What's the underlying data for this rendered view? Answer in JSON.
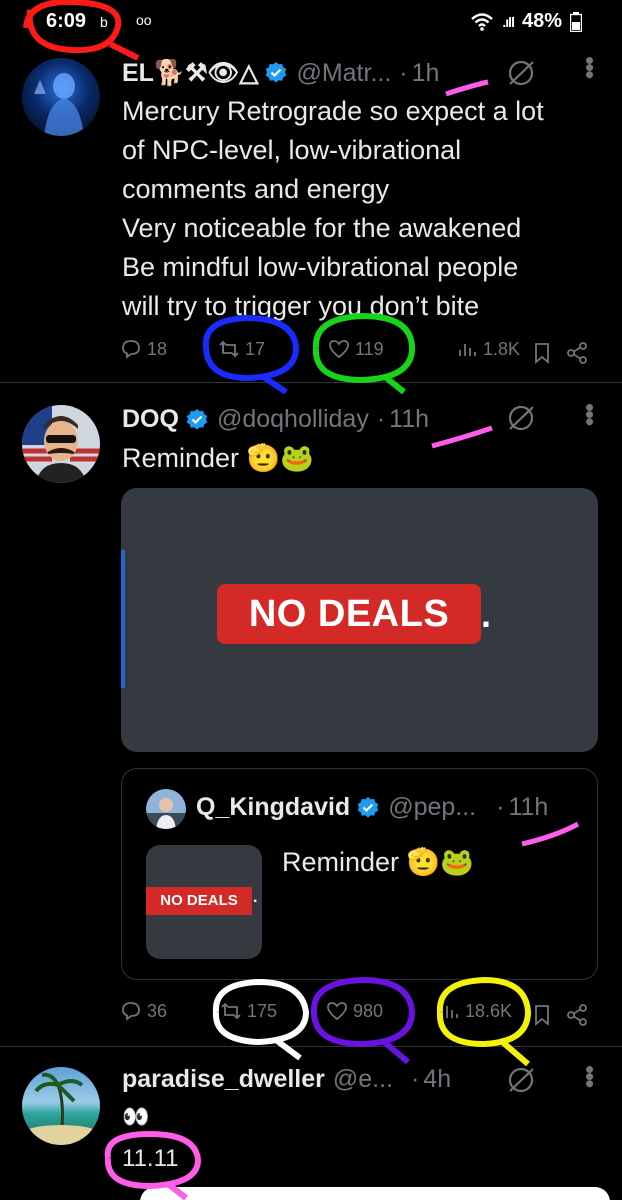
{
  "status_bar": {
    "time": "6:09",
    "small_icon": "b",
    "voicemail": "oo",
    "battery": "48%",
    "signal": ".ıll"
  },
  "tweets": [
    {
      "name": "EL🐕⚒👁△",
      "handle": "@Matr...",
      "dot": "·",
      "time": "1h",
      "text_lines": [
        "Mercury Retrograde so expect a lot",
        "of NPC-level, low-vibrational",
        "comments and energy",
        "Very noticeable for the awakened",
        "Be mindful low-vibrational people",
        "will try to trigger you don’t bite"
      ],
      "replies": "18",
      "reposts": "17",
      "likes": "119",
      "views": "1.8K"
    },
    {
      "name": "DOQ",
      "handle": "@doqholliday",
      "dot": "·",
      "time": "11h",
      "text": "Reminder 🫡🐸",
      "media_text": "NO DEALS",
      "media_dot": ".",
      "quote": {
        "name": "Q_Kingdavid",
        "handle": "@pep...",
        "dot": "·",
        "time": "11h",
        "text": "Reminder 🫡🐸",
        "thumb_text": "NO DEALS",
        "thumb_dot": "."
      },
      "replies": "36",
      "reposts": "175",
      "likes": "980",
      "views": "18.6K"
    },
    {
      "name": "paradise_dweller",
      "handle": "@e...",
      "dot": "·",
      "time": "4h",
      "emoji_line": "👀",
      "text": "11.11"
    }
  ],
  "colors": {
    "background": "#000000",
    "text": "#e7e9ea",
    "muted": "#71767b",
    "verified": "#1d9bf0",
    "badge_red": "#d32a27",
    "media_bg": "#353a40",
    "annotation_red": "#ff1a1a",
    "annotation_blue": "#1a2bff",
    "annotation_green": "#18d418",
    "annotation_magenta": "#ff5ce8",
    "annotation_white": "#ffffff",
    "annotation_purple": "#6a12e0",
    "annotation_yellow": "#f2f20a"
  },
  "icons": [
    "wifi-icon",
    "signal-icon",
    "battery-icon",
    "verified-icon",
    "grok-icon",
    "more-icon",
    "reply-icon",
    "repost-icon",
    "like-icon",
    "views-icon",
    "bookmark-icon",
    "share-icon"
  ]
}
